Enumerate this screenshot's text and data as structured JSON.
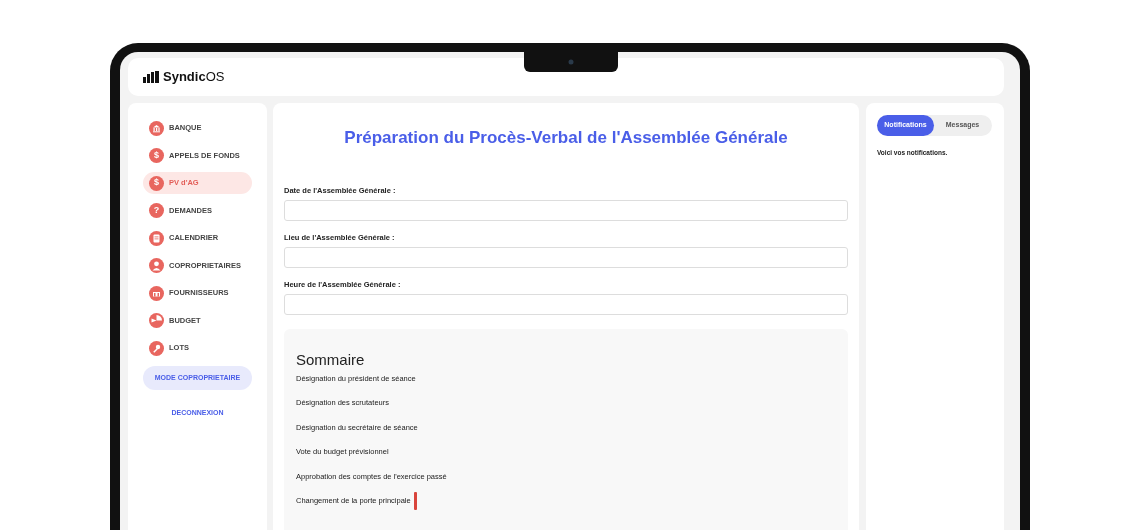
{
  "app": {
    "logo": "**Syndic**OS"
  },
  "sidebar": {
    "items": [
      {
        "label": "BANQUE",
        "kind": "bank",
        "selected": false
      },
      {
        "label": "APPELS DE FONDS",
        "kind": "dollar",
        "glyph": "$",
        "selected": false
      },
      {
        "label": "PV d'AG",
        "kind": "dollar",
        "glyph": "$",
        "selected": true
      },
      {
        "label": "DEMANDES",
        "kind": "question",
        "glyph": "?",
        "selected": false
      },
      {
        "label": "CALENDRIER",
        "kind": "clipboard",
        "selected": false
      },
      {
        "label": "COPROPRIETAIRES",
        "kind": "person",
        "selected": false
      },
      {
        "label": "FOURNISSEURS",
        "kind": "store",
        "selected": false
      },
      {
        "label": "BUDGET",
        "kind": "pie",
        "selected": false
      },
      {
        "label": "LOTS",
        "kind": "key",
        "selected": false
      }
    ],
    "mode_button": "MODE COPROPRIETAIRE",
    "logout_link": "DECONNEXION"
  },
  "main": {
    "title": "Préparation du Procès-Verbal de l'Assemblée Générale",
    "fields": [
      {
        "label": "Date de l'Assemblée Générale :"
      },
      {
        "label": "Lieu de l'Assemblée Générale :"
      },
      {
        "label": "Heure de l'Assemblée Générale :"
      }
    ],
    "summary": {
      "heading": "Sommaire",
      "items": [
        {
          "text": "Désignation du président de séance",
          "cursor": false
        },
        {
          "text": "Désignation des scrutateurs",
          "cursor": false
        },
        {
          "text": "Désignation du secrétaire de séance",
          "cursor": false
        },
        {
          "text": "Vote du budget prévisionnel",
          "cursor": false
        },
        {
          "text": "Approbation des comptes de l'exercice passé",
          "cursor": false
        },
        {
          "text": "Changement de la porte principale",
          "cursor": true
        }
      ]
    }
  },
  "panel": {
    "tabs": [
      {
        "label": "Notifications",
        "selected": true
      },
      {
        "label": "Messages",
        "selected": false
      }
    ],
    "message": "Voici vos notifications."
  }
}
